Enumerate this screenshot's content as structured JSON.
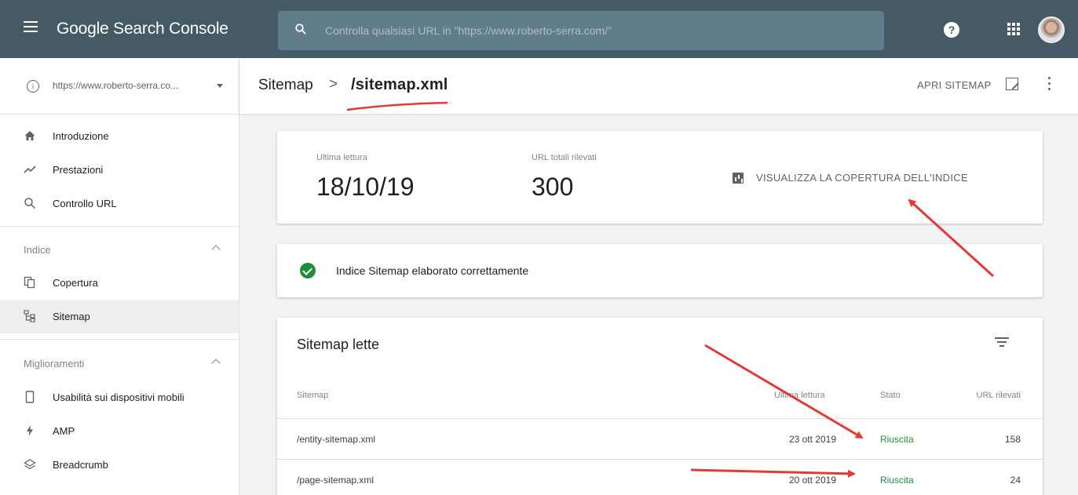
{
  "app": {
    "title": "Google Search Console"
  },
  "search": {
    "placeholder": "Controlla qualsiasi URL in \"https://www.roberto-serra.com/\""
  },
  "property": {
    "label": "https://www.roberto-serra.co..."
  },
  "sidebar": {
    "items": [
      {
        "label": "Introduzione",
        "icon": "home-icon"
      },
      {
        "label": "Prestazioni",
        "icon": "trending-up-icon"
      },
      {
        "label": "Controllo URL",
        "icon": "search-icon"
      }
    ],
    "sections": [
      {
        "label": "Indice",
        "items": [
          {
            "label": "Copertura",
            "icon": "pages-icon"
          },
          {
            "label": "Sitemap",
            "icon": "sitemap-icon",
            "active": true
          }
        ]
      },
      {
        "label": "Miglioramenti",
        "items": [
          {
            "label": "Usabilità sui dispositivi mobili",
            "icon": "phone-icon"
          },
          {
            "label": "AMP",
            "icon": "bolt-icon"
          },
          {
            "label": "Breadcrumb",
            "icon": "layers-icon"
          }
        ]
      }
    ]
  },
  "header": {
    "crumb_parent": "Sitemap",
    "crumb_separator": ">",
    "crumb_current": "/sitemap.xml",
    "open_sitemap": "APRI SITEMAP"
  },
  "summary": {
    "last_read_label": "Ultima lettura",
    "last_read_value": "18/10/19",
    "total_urls_label": "URL totali rilevati",
    "total_urls_value": "300",
    "coverage_link": "VISUALIZZA LA COPERTURA DELL'INDICE"
  },
  "status": {
    "message": "Indice Sitemap elaborato correttamente",
    "color": "#1e8e3e"
  },
  "table": {
    "title": "Sitemap lette",
    "columns": [
      "Sitemap",
      "Ultima lettura",
      "Stato",
      "URL rilevati"
    ],
    "rows": [
      {
        "sitemap": "/entity-sitemap.xml",
        "last_read": "23 ott 2019",
        "status": "Riuscita",
        "urls": "158"
      },
      {
        "sitemap": "/page-sitemap.xml",
        "last_read": "20 ott 2019",
        "status": "Riuscita",
        "urls": "24"
      }
    ]
  },
  "colors": {
    "topbar": "#455a64",
    "search_bg": "#607d8b",
    "success": "#1e8e3e",
    "annotation": "#e53935"
  }
}
